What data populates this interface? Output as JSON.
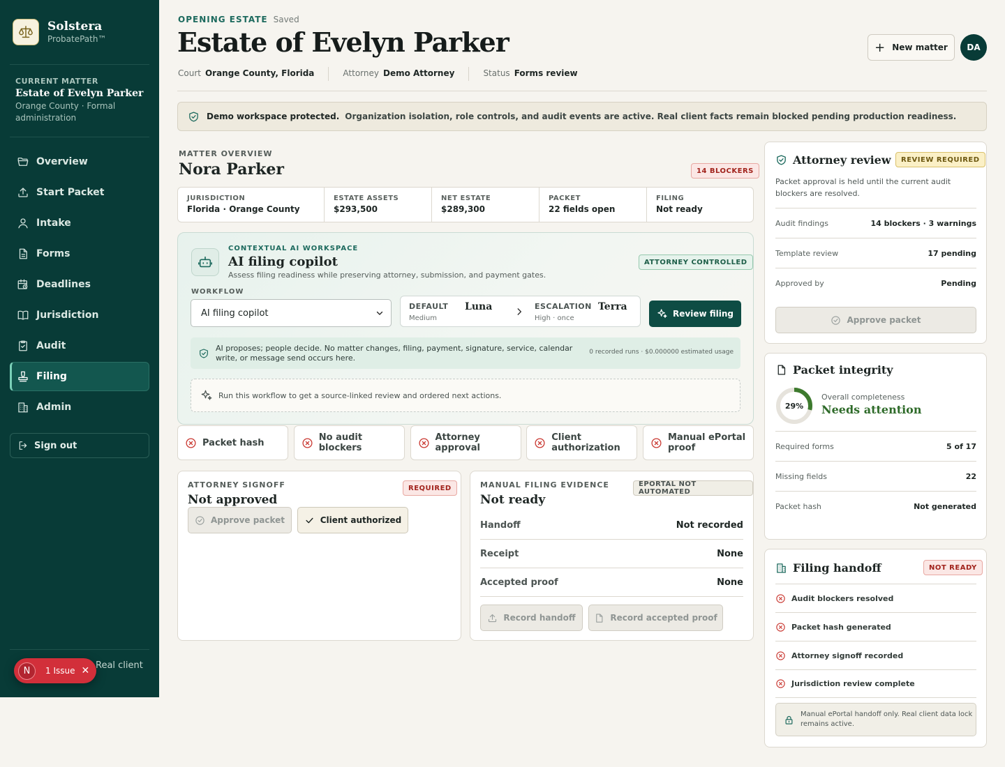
{
  "brand": {
    "name": "Solstera",
    "sub": "ProbatePath™"
  },
  "current_matter": {
    "label": "CURRENT MATTER",
    "name": "Estate of Evelyn Parker",
    "sub": "Orange County · Formal administration"
  },
  "nav": [
    {
      "label": "Overview",
      "icon": "folder-icon",
      "active": false
    },
    {
      "label": "Start Packet",
      "icon": "upload-icon",
      "active": false
    },
    {
      "label": "Intake",
      "icon": "user-icon",
      "active": false
    },
    {
      "label": "Forms",
      "icon": "document-icon",
      "active": false
    },
    {
      "label": "Deadlines",
      "icon": "calendar-clock-icon",
      "active": false
    },
    {
      "label": "Jurisdiction",
      "icon": "book-icon",
      "active": false
    },
    {
      "label": "Audit",
      "icon": "clipboard-check-icon",
      "active": false
    },
    {
      "label": "Filing",
      "icon": "stamp-icon",
      "active": true
    },
    {
      "label": "Admin",
      "icon": "building-icon",
      "active": false
    }
  ],
  "signout": "Sign out",
  "sidebar_footer": "Real client",
  "issue_pill": {
    "badge": "N",
    "text": "1 Issue"
  },
  "header": {
    "kicker": "OPENING ESTATE",
    "saved": "Saved",
    "title": "Estate of Evelyn Parker",
    "meta": [
      {
        "key": "Court",
        "value": "Orange County, Florida"
      },
      {
        "key": "Attorney",
        "value": "Demo Attorney"
      },
      {
        "key": "Status",
        "value": "Forms review"
      }
    ],
    "new_matter": "New matter",
    "avatar": "DA"
  },
  "banner": {
    "bold": "Demo workspace protected.",
    "text": "Organization isolation, role controls, and audit events are active. Real client facts remain blocked pending production readiness."
  },
  "matter_overview": {
    "label": "MATTER OVERVIEW",
    "name": "Nora Parker",
    "blockers_badge": "14 BLOCKERS",
    "stats": [
      {
        "key": "JURISDICTION",
        "value": "Florida · Orange County"
      },
      {
        "key": "ESTATE ASSETS",
        "value": "$293,500"
      },
      {
        "key": "NET ESTATE",
        "value": "$289,300"
      },
      {
        "key": "PACKET",
        "value": "22 fields open"
      },
      {
        "key": "FILING",
        "value": "Not ready"
      }
    ]
  },
  "copilot": {
    "kicker": "CONTEXTUAL AI WORKSPACE",
    "title": "AI filing copilot",
    "subtitle": "Assess filing readiness while preserving attorney, submission, and payment gates.",
    "badge": "ATTORNEY CONTROLLED",
    "workflow_label": "WORKFLOW",
    "workflow_value": "AI filing copilot",
    "default_label": "DEFAULT",
    "default_sub": "Medium",
    "default_model": "Luna",
    "escalation_label": "ESCALATION",
    "escalation_sub": "High · once",
    "escalation_model": "Terra",
    "review_button": "Review filing",
    "note": "AI proposes; people decide. No matter changes, filing, payment, signature, service, calendar write, or message send occurs here.",
    "usage": "0 recorded runs · $0.000000 estimated usage",
    "run_hint": "Run this workflow to get a source-linked review and ordered next actions."
  },
  "gates": [
    {
      "label": "Packet hash"
    },
    {
      "label": "No audit blockers"
    },
    {
      "label": "Attorney approval"
    },
    {
      "label": "Client authorization"
    },
    {
      "label": "Manual ePortal proof"
    }
  ],
  "attorney_signoff": {
    "kicker": "ATTORNEY SIGNOFF",
    "badge": "REQUIRED",
    "status": "Not approved",
    "approve_button": "Approve packet",
    "client_button": "Client authorized"
  },
  "manual_filing": {
    "kicker": "MANUAL FILING EVIDENCE",
    "badge": "EPORTAL NOT AUTOMATED",
    "status": "Not ready",
    "rows": [
      {
        "key": "Handoff",
        "value": "Not recorded"
      },
      {
        "key": "Receipt",
        "value": "None"
      },
      {
        "key": "Accepted proof",
        "value": "None"
      }
    ],
    "record_handoff": "Record handoff",
    "record_proof": "Record accepted proof"
  },
  "attorney_review": {
    "title": "Attorney review",
    "badge": "REVIEW REQUIRED",
    "desc": "Packet approval is held until the current audit blockers are resolved.",
    "rows": [
      {
        "key": "Audit findings",
        "value": "14 blockers · 3 warnings"
      },
      {
        "key": "Template review",
        "value": "17 pending"
      },
      {
        "key": "Approved by",
        "value": "Pending"
      }
    ],
    "approve_button": "Approve packet"
  },
  "packet_integrity": {
    "title": "Packet integrity",
    "completeness_percent": 29,
    "completeness_label": "29%",
    "overall_label": "Overall completeness",
    "overall_value": "Needs attention",
    "rows": [
      {
        "key": "Required forms",
        "value": "5 of 17"
      },
      {
        "key": "Missing fields",
        "value": "22"
      },
      {
        "key": "Packet hash",
        "value": "Not generated"
      }
    ]
  },
  "filing_handoff": {
    "title": "Filing handoff",
    "badge": "NOT READY",
    "items": [
      {
        "label": "Audit blockers resolved"
      },
      {
        "label": "Packet hash generated"
      },
      {
        "label": "Attorney signoff recorded"
      },
      {
        "label": "Jurisdiction review complete"
      }
    ],
    "note": "Manual ePortal handoff only. Real client data lock remains active."
  },
  "colors": {
    "sidebar": "#083b37",
    "accent": "#0e4c44",
    "danger": "#c9362f",
    "success": "#2f6b2a"
  }
}
